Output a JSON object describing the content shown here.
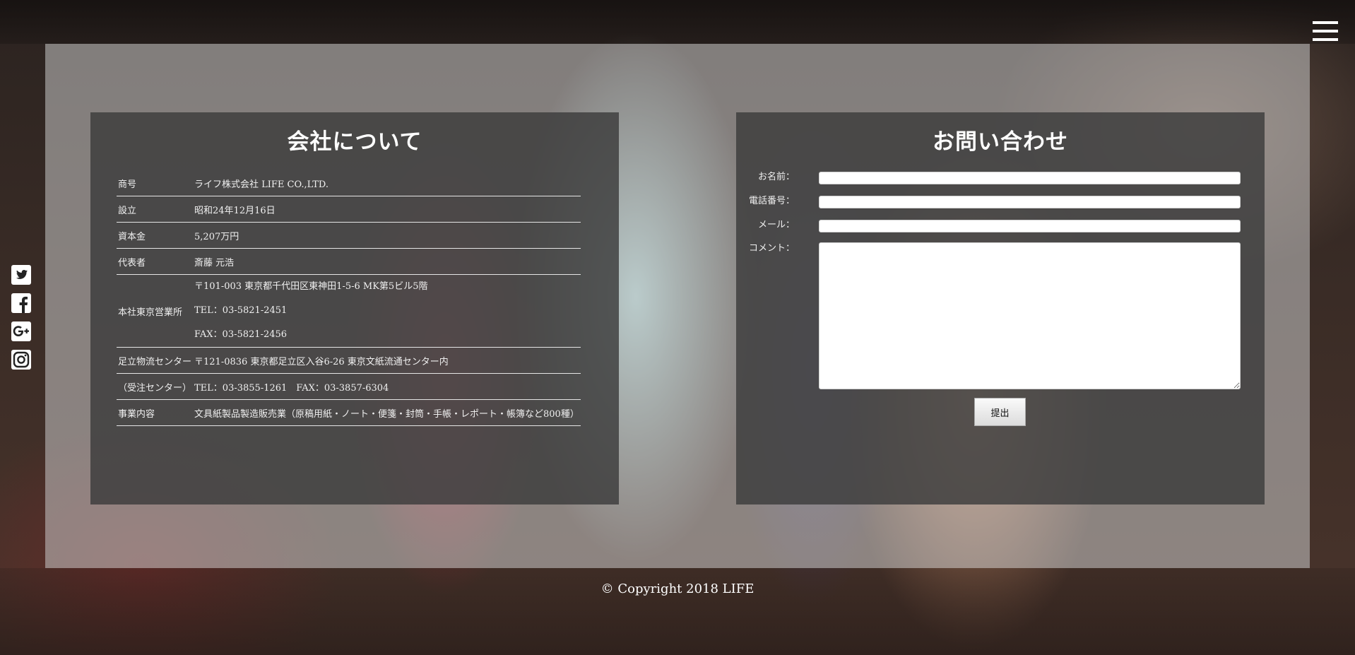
{
  "about": {
    "title": "会社について",
    "rows": [
      {
        "label": "商号",
        "values": [
          "ライフ株式会社 LIFE CO.,LTD."
        ]
      },
      {
        "label": "設立",
        "values": [
          "昭和24年12月16日"
        ]
      },
      {
        "label": "資本金",
        "values": [
          "5,207万円"
        ]
      },
      {
        "label": "代表者",
        "values": [
          "斎藤 元浩"
        ]
      },
      {
        "label": "本社東京営業所",
        "values": [
          "〒101-003 東京都千代田区東神田1-5-6 MK第5ビル5階",
          "TEL：03-5821-2451",
          "FAX：03-5821-2456"
        ]
      },
      {
        "label": "足立物流センター",
        "values": [
          "〒121-0836 東京都足立区入谷6-26 東京文紙流通センター内"
        ]
      },
      {
        "label": "（受注センター）",
        "values": [
          "TEL：03-3855-1261　FAX：03-3857-6304"
        ]
      },
      {
        "label": "事業内容",
        "values": [
          "文具紙製品製造販売業（原稿用紙・ノート・便箋・封筒・手帳・レポート・帳簿など800種）"
        ]
      }
    ]
  },
  "contact": {
    "title": "お問い合わせ",
    "name_label": "お名前：",
    "phone_label": "電話番号：",
    "email_label": "メール：",
    "comment_label": "コメント：",
    "name_value": "",
    "phone_value": "",
    "email_value": "",
    "comment_value": "",
    "submit_label": "提出"
  },
  "footer": {
    "copyright": "© Copyright 2018 LIFE"
  },
  "social": {
    "icons": [
      "twitter-icon",
      "facebook-icon",
      "google-plus-icon",
      "instagram-icon"
    ]
  },
  "menu": {
    "icon": "hamburger-menu-icon"
  }
}
